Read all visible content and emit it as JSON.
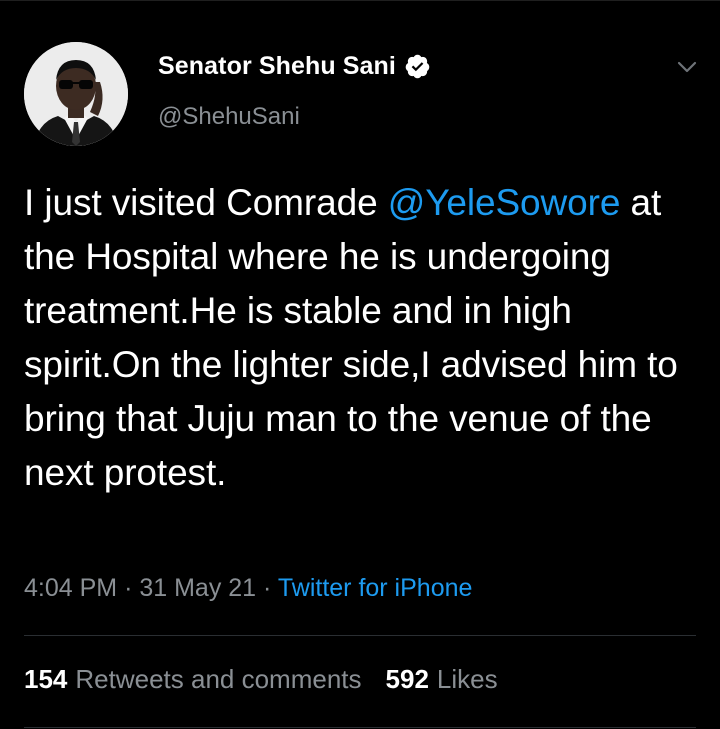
{
  "tweet": {
    "author": {
      "display_name": "Senator Shehu Sani",
      "handle": "@ShehuSani",
      "verified": true
    },
    "text_before_mention": "I just visited Comrade ",
    "mention": "@YeleSowore",
    "text_after_mention": " at the Hospital where he is undergoing treatment.He is stable and in high spirit.On the lighter side,I advised him to bring that Juju man to the venue of the next protest.",
    "time": "4:04 PM",
    "date": "31 May 21",
    "meta_separator": "·",
    "source": "Twitter for iPhone",
    "retweets_count": "154",
    "retweets_label": "Retweets and comments",
    "likes_count": "592",
    "likes_label": "Likes"
  },
  "icons": {
    "verified": "verified-badge-icon",
    "menu": "chevron-down-icon"
  },
  "colors": {
    "background": "#000000",
    "text": "#ffffff",
    "secondary_text": "#8a8f94",
    "link": "#1d9bf0",
    "divider": "#2a2e32"
  }
}
